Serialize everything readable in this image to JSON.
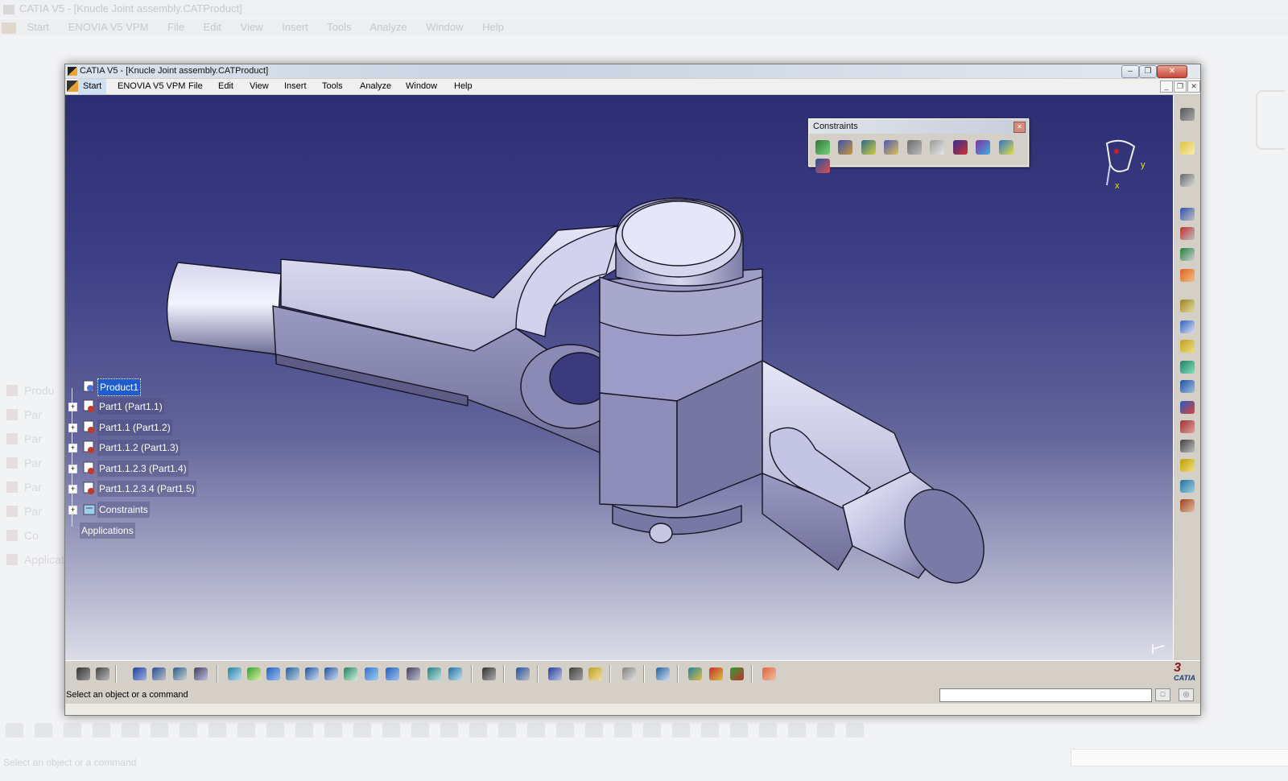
{
  "window": {
    "title": "CATIA V5 - [Knucle Joint assembly.CATProduct]",
    "controls": {
      "minimize": "–",
      "restore": "❐",
      "close": "✕"
    }
  },
  "menu": {
    "items": [
      "Start",
      "ENOVIA V5 VPM",
      "File",
      "Edit",
      "View",
      "Insert",
      "Tools",
      "Analyze",
      "Window",
      "Help"
    ]
  },
  "tree": {
    "root": "Product1",
    "children": [
      "Part1 (Part1.1)",
      "Part1.1 (Part1.2)",
      "Part1.1.2 (Part1.3)",
      "Part1.1.2.3 (Part1.4)",
      "Part1.1.2.3.4 (Part1.5)",
      "Constraints",
      "Applications"
    ]
  },
  "constraints_toolbar": {
    "title": "Constraints",
    "icons": [
      "coincidence-icon",
      "contact-icon",
      "offset-icon",
      "angle-icon",
      "fix-icon",
      "fix-together-icon",
      "quick-constraint-icon",
      "flexible-rigid-icon",
      "change-constraint-icon",
      "reuse-pattern-icon"
    ]
  },
  "compass": {
    "x_label": "x",
    "y_label": "y"
  },
  "status": {
    "prompt": "Select an object or a command"
  },
  "logo": {
    "brand": "CATIA"
  },
  "colors": {
    "viewport_top": "#2c2d73",
    "viewport_bottom": "#dcdce8",
    "part_face": "#b4b4d8",
    "selection": "#1f5ccf"
  }
}
